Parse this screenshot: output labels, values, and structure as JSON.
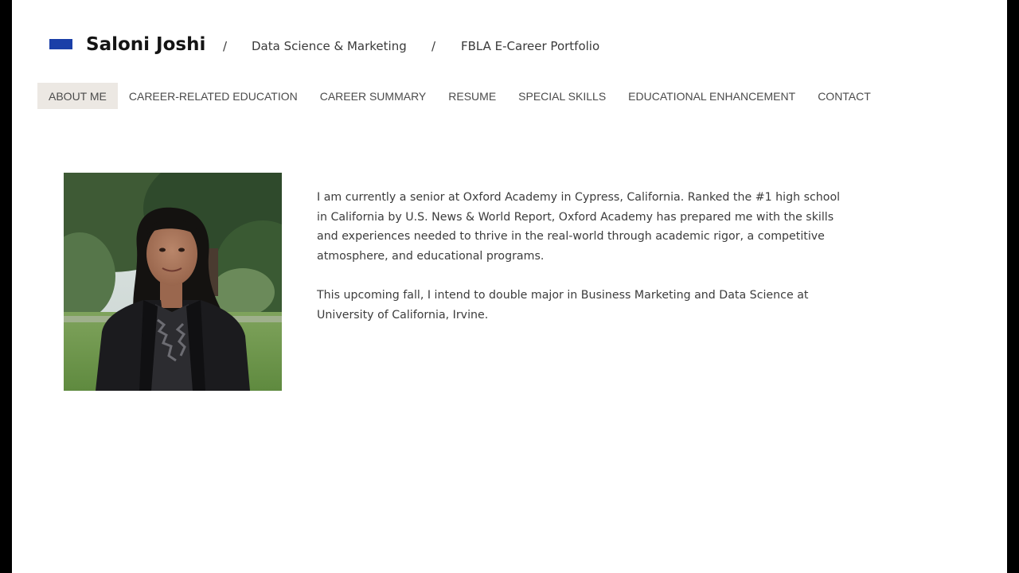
{
  "header": {
    "name": "Saloni Joshi",
    "separator": "/",
    "breadcrumbs": [
      "Data Science & Marketing",
      "FBLA E-Career Portfolio"
    ],
    "brand_color": "#1a3fa8"
  },
  "nav": {
    "items": [
      {
        "label": "ABOUT ME",
        "active": true
      },
      {
        "label": "CAREER-RELATED EDUCATION",
        "active": false
      },
      {
        "label": "CAREER SUMMARY",
        "active": false
      },
      {
        "label": "RESUME",
        "active": false
      },
      {
        "label": "SPECIAL SKILLS",
        "active": false
      },
      {
        "label": "EDUCATIONAL ENHANCEMENT",
        "active": false
      },
      {
        "label": "CONTACT",
        "active": false
      }
    ],
    "active_bg": "#ece8e3"
  },
  "about": {
    "paragraphs": [
      "I am currently a senior at Oxford Academy in Cypress, California. Ranked the #1 high school in California by U.S. News & World Report, Oxford Academy has prepared me with the skills and experiences needed to thrive in the real-world through academic rigor, a competitive atmosphere, and educational programs.",
      "This upcoming fall, I intend to double major in Business Marketing and Data Science at University of California, Irvine."
    ]
  }
}
